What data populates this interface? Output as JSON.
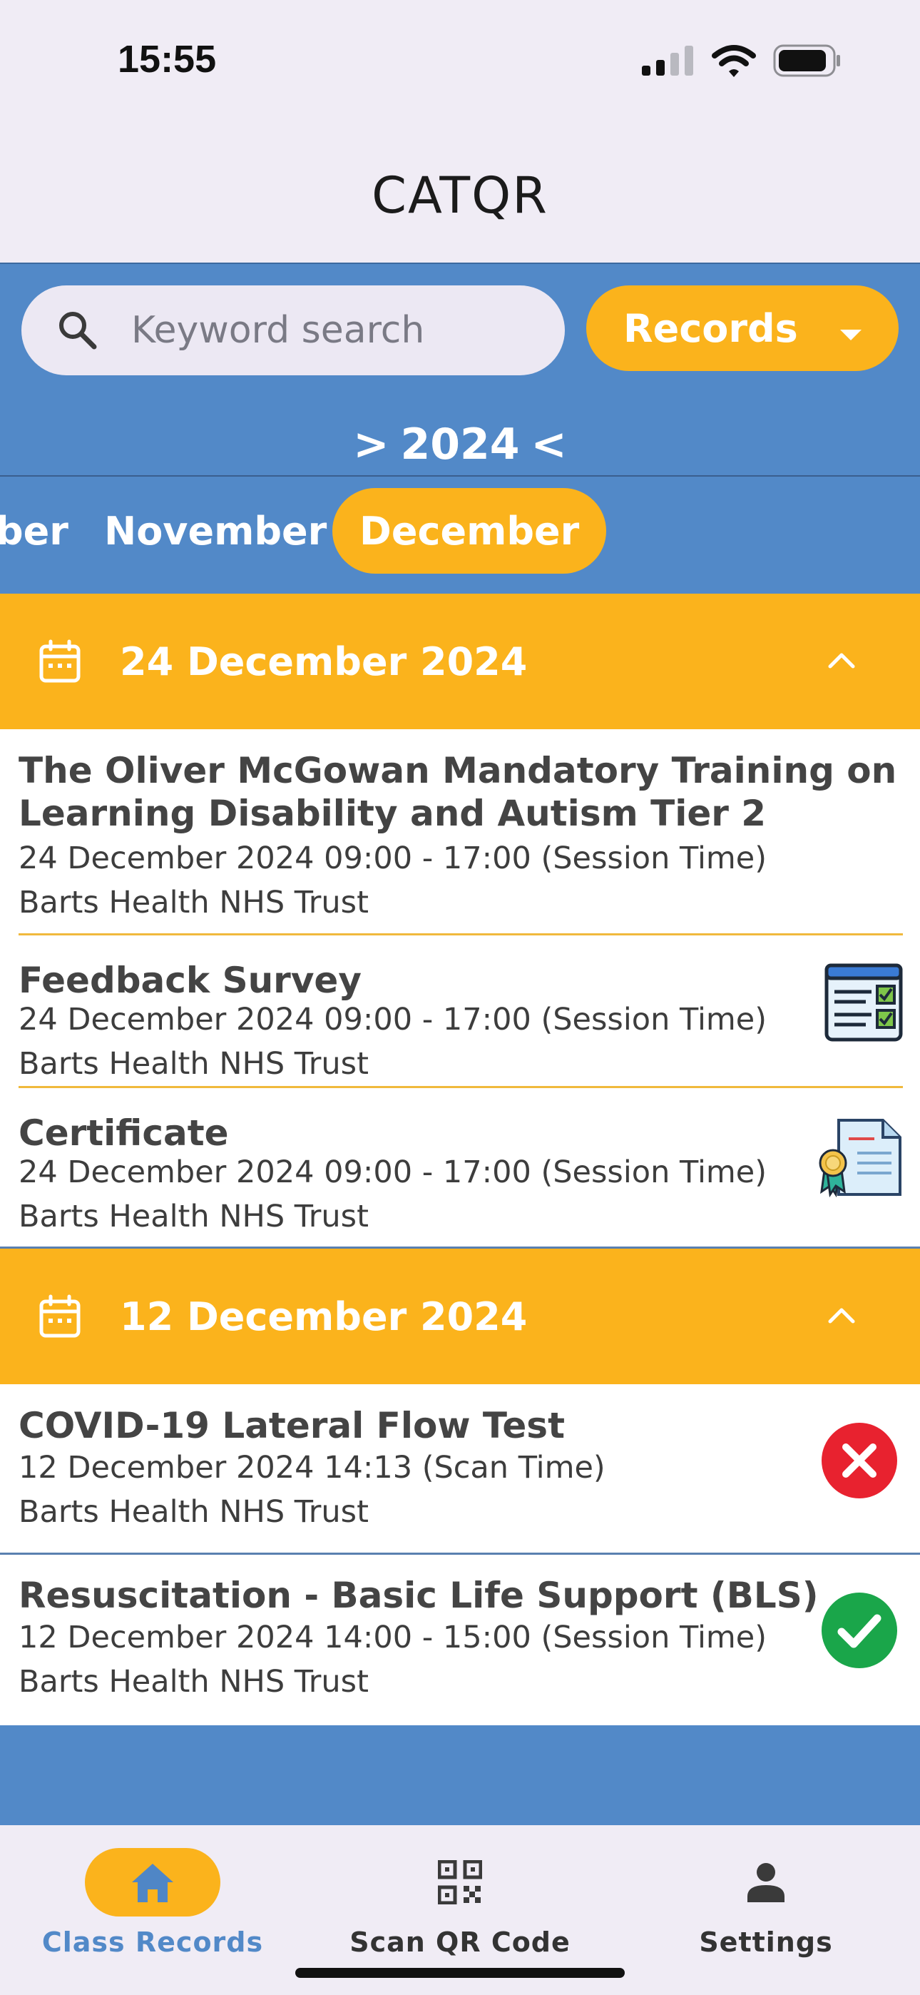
{
  "status_bar": {
    "time": "15:55"
  },
  "header": {
    "title": "CATQR"
  },
  "search": {
    "placeholder": "Keyword search"
  },
  "filter": {
    "label": "Records"
  },
  "year_nav": {
    "prev": ">",
    "year": "2024",
    "next": "<"
  },
  "months": [
    {
      "label": "ber"
    },
    {
      "label": "November"
    },
    {
      "label": "December",
      "selected": true
    }
  ],
  "groups": [
    {
      "date": "24 December 2024",
      "records": [
        {
          "title_line1": "The Oliver McGowan Mandatory Training on",
          "title_line2": "Learning Disability and Autism Tier 2",
          "time": "24 December 2024 09:00 - 17:00 (Session Time)",
          "org": "Barts Health NHS Trust",
          "icon": "none"
        },
        {
          "title": "Feedback Survey",
          "time": "24 December 2024 09:00 - 17:00 (Session Time)",
          "org": "Barts Health NHS Trust",
          "icon": "survey-checklist-icon"
        },
        {
          "title": "Certificate",
          "time": "24 December 2024 09:00 - 17:00 (Session Time)",
          "org": "Barts Health NHS Trust",
          "icon": "certificate-icon"
        }
      ]
    },
    {
      "date": "12 December 2024",
      "records": [
        {
          "title": "COVID-19 Lateral Flow Test",
          "time": "12 December 2024 14:13 (Scan Time)",
          "org": "Barts Health NHS Trust",
          "icon": "red-cross-icon"
        },
        {
          "title": "Resuscitation - Basic Life Support (BLS)",
          "time": "12 December 2024 14:00 - 15:00 (Session Time)",
          "org": "Barts Health NHS Trust",
          "icon": "green-check-icon"
        }
      ]
    }
  ],
  "bottom_nav": {
    "items": [
      {
        "label": "Class Records",
        "icon": "home-icon",
        "active": true
      },
      {
        "label": "Scan QR Code",
        "icon": "qr-code-icon"
      },
      {
        "label": "Settings",
        "icon": "person-icon"
      }
    ]
  },
  "colors": {
    "accent_yellow": "#fbb31c",
    "primary_blue": "#5289c8",
    "header_bg": "#f0ecf5",
    "active_nav_text": "#5289c8"
  }
}
